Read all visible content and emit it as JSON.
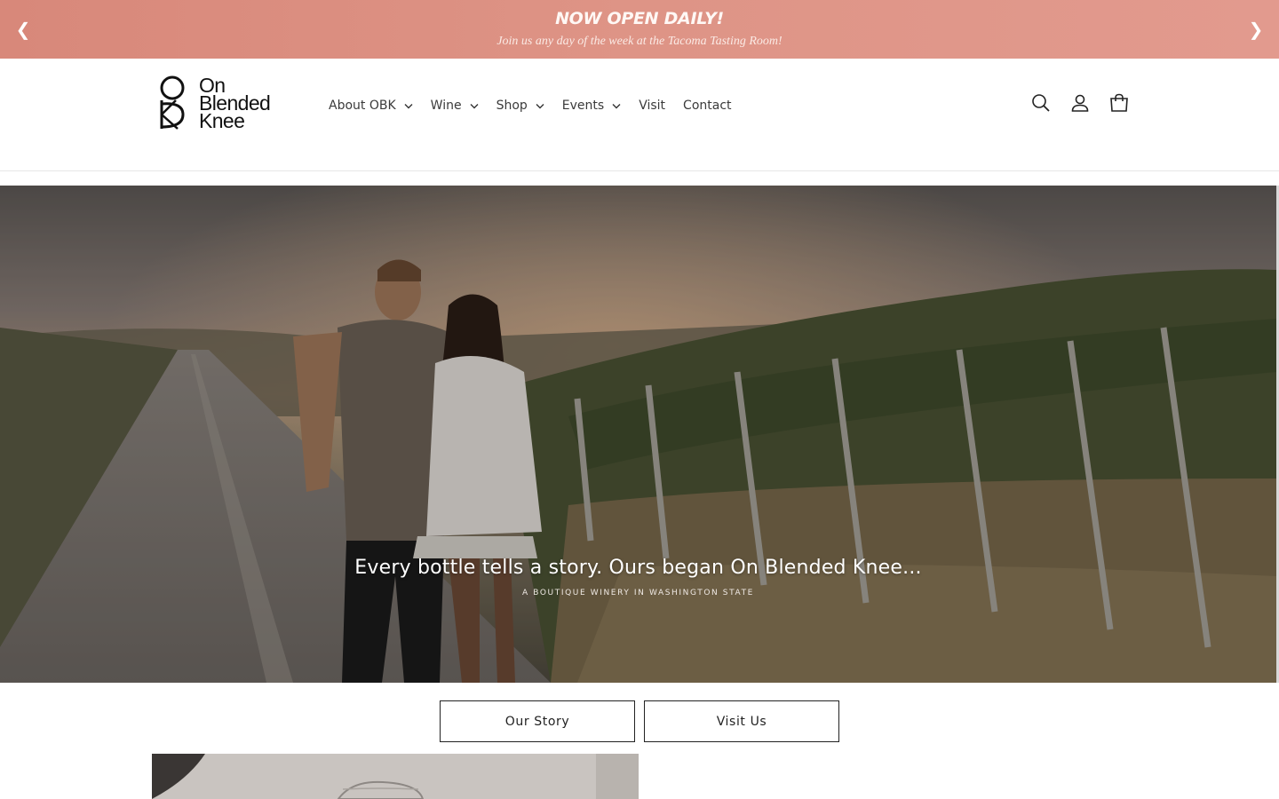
{
  "announcement": {
    "title": "NOW OPEN DAILY!",
    "subtitle": "Join us any day of the week at the Tacoma Tasting Room!",
    "prev_icon": "❮",
    "next_icon": "❯",
    "background_color": "#dc8f81"
  },
  "header": {
    "logo": {
      "line1": "On",
      "line2": "Blended",
      "line3": "Knee"
    },
    "nav": [
      {
        "label": "About OBK",
        "has_dropdown": true
      },
      {
        "label": "Wine",
        "has_dropdown": true
      },
      {
        "label": "Shop",
        "has_dropdown": true
      },
      {
        "label": "Events",
        "has_dropdown": true
      },
      {
        "label": "Visit",
        "has_dropdown": false
      },
      {
        "label": "Contact",
        "has_dropdown": false
      }
    ],
    "icons": [
      "search-icon",
      "account-icon",
      "cart-icon"
    ]
  },
  "hero": {
    "headline": "Every bottle tells a story. Ours began On Blended Knee...",
    "tagline": "A BOUTIQUE WINERY IN WASHINGTON STATE"
  },
  "buttons": {
    "our_story": "Our Story",
    "visit_us": "Visit Us"
  }
}
